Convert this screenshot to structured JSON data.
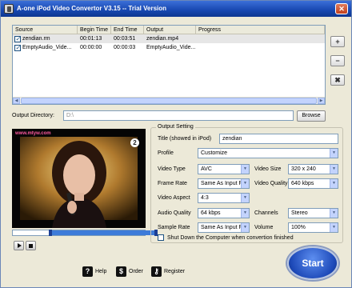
{
  "window": {
    "title": "A-one iPod Video Convertor V3.15 -- Trial Version",
    "close_glyph": "✕"
  },
  "list": {
    "headers": [
      "Source",
      "Begin Time",
      "End Time",
      "Output",
      "Progress"
    ],
    "rows": [
      {
        "source": "zendian.rm",
        "begin": "00:01:13",
        "end": "00:03:51",
        "output": "zendian.mp4",
        "progress": "",
        "checked": true,
        "selected": true
      },
      {
        "source": "EmptyAudio_Vide...",
        "begin": "00:00:00",
        "end": "00:00:03",
        "output": "EmptyAudio_Vide...",
        "progress": "",
        "checked": true,
        "selected": false
      }
    ]
  },
  "side_buttons": {
    "add": "+",
    "remove": "−",
    "clear": "✖"
  },
  "output_directory": {
    "label": "Output Directory:",
    "value": "D:\\",
    "browse": "Browse"
  },
  "video": {
    "watermark": "www.mtyw.com",
    "channel_logo": "2"
  },
  "output_setting": {
    "title": "Output Setting",
    "title_label": "Title (showed in iPod)",
    "title_value": "zendian",
    "profile_label": "Profile",
    "profile_value": "Customize",
    "video_type_label": "Video Type",
    "video_type_value": "AVC",
    "video_size_label": "Video Size",
    "video_size_value": "320 x 240",
    "frame_rate_label": "Frame Rate",
    "frame_rate_value": "Same As Input F",
    "video_quality_label": "Video Quality",
    "video_quality_value": "640  kbps",
    "video_aspect_label": "Video Aspect",
    "video_aspect_value": "4:3",
    "audio_quality_label": "Audio Quality",
    "audio_quality_value": "64   kbps",
    "channels_label": "Channels",
    "channels_value": "Stereo",
    "sample_rate_label": "Sample Rate",
    "sample_rate_value": "Same As Input F",
    "volume_label": "Volume",
    "volume_value": "100%",
    "shutdown_label": "Shut Down the Computer when convertion finished"
  },
  "bottom": {
    "help": "Help",
    "order": "Order",
    "register": "Register",
    "start": "Start"
  }
}
